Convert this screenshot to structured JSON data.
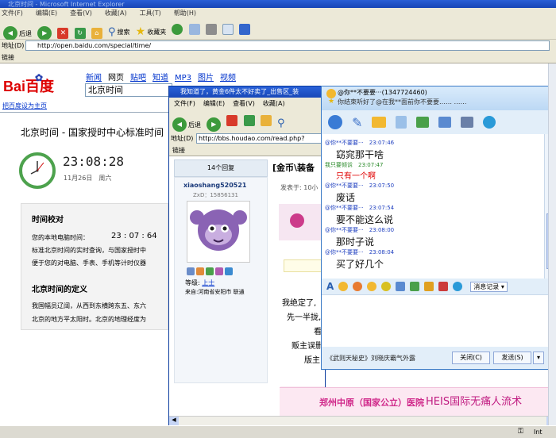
{
  "ie": {
    "window_title": "北京时间 - Microsoft Internet Explorer",
    "menu": [
      "文件(F)",
      "编辑(E)",
      "查看(V)",
      "收藏(A)",
      "工具(T)",
      "帮助(H)"
    ],
    "toolbar": {
      "back": "后退",
      "search": "搜索",
      "favorites": "收藏夹"
    },
    "address_label": "地址(D)",
    "address": "http://open.baidu.com/special/time/",
    "links_label": "链接"
  },
  "baidu": {
    "logo": "Bai百度",
    "nav": [
      "新闻",
      "网页",
      "贴吧",
      "知道",
      "MP3",
      "图片",
      "视频"
    ],
    "search_value": "北京时间",
    "set_home": "把百度设为主页",
    "heading": "北京时间 - 国家授时中心标准时间",
    "clock_time": "23:08:28",
    "clock_date": "11月26日　周六",
    "sync_title": "时间校对",
    "local_time_label": "您的本地电脑时间：",
    "local_time": "23 : 07 : 64",
    "sync_text1": "标准北京时间的实时查询，与国家授时中",
    "sync_text2": "便于您的对电脑、手表、手机等计时仪器",
    "def_title": "北京时间的定义",
    "def_text1": "我国幅员辽阔，从西到东横跨东五、东六",
    "def_text2": "北京的地方平太阳时。北京的地理经度为"
  },
  "forum": {
    "window_title": "我知道了，黄金6件太不好卖了_出售区_装",
    "menu": [
      "文件(F)",
      "编辑(E)",
      "查看(V)",
      "收藏(A)"
    ],
    "back": "后退",
    "address_label": "地址(D)",
    "address": "http://bbs.houdao.com/read.php?",
    "links_label": "链接",
    "replies": "14个回复",
    "thread_title": "[金币\\装备",
    "username": "xiaoshang520521",
    "zxd": "ZxD：15856131",
    "posted_at": "发表于: 10小",
    "level_label": "等级:",
    "level": "上士",
    "origin": "来自:河南省安阳市 联通",
    "post_lines": [
      "我绝定了,",
      "先一半拢,",
      "看",
      "贩主误删",
      "版主"
    ],
    "banner_left": "郑州中原（国家公立）医院",
    "banner_right": "HEIS国际无痛人流术"
  },
  "qq": {
    "contact": "@你**不要要···",
    "contact_id": "(1347724460)",
    "signature": "你结束听好了@在我**面前你不要要…… ……",
    "messages": [
      {
        "who": "@你**不要要···",
        "time": "23:07:46",
        "text": "窈窕那干啥",
        "color": "#111"
      },
      {
        "who": "我只要倾诉",
        "time": "23:07:47",
        "text": "只有一个啊",
        "color": "#e00000"
      },
      {
        "who": "@你**不要要···",
        "time": "23:07:50",
        "text": "废话",
        "color": "#111"
      },
      {
        "who": "@你**不要要···",
        "time": "23:07:54",
        "text": "要不能这么说",
        "color": "#111"
      },
      {
        "who": "@你**不要要···",
        "time": "23:08:00",
        "text": "那时子说",
        "color": "#111"
      },
      {
        "who": "@你**不要要···",
        "time": "23:08:04",
        "text": "买了好几个",
        "color": "#111"
      }
    ],
    "history_btn": "消息记录",
    "ad": "《武则天秘史》刘晓庆霸气外露",
    "close_btn": "关闭(C)",
    "send_btn": "发送(S)"
  },
  "taskbar": {
    "zone": "Int"
  }
}
